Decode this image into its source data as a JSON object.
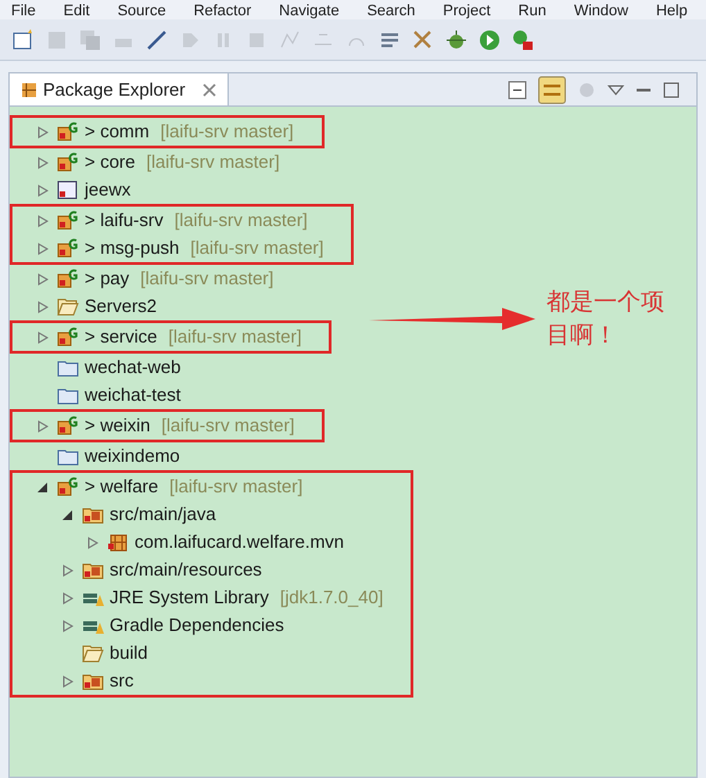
{
  "menu": [
    "File",
    "Edit",
    "Source",
    "Refactor",
    "Navigate",
    "Search",
    "Project",
    "Run",
    "Window",
    "Help"
  ],
  "view": {
    "title": "Package Explorer"
  },
  "tree": [
    {
      "label": "> comm",
      "branch": "[laifu-srv master]",
      "kind": "git-project",
      "expanded": false,
      "boxed": true
    },
    {
      "label": "> core",
      "branch": "[laifu-srv master]",
      "kind": "git-project",
      "expanded": false,
      "boxed": false
    },
    {
      "label": "jeewx",
      "kind": "web-project",
      "expanded": false,
      "boxed": false
    },
    {
      "label": "> laifu-srv",
      "branch": "[laifu-srv master]",
      "kind": "git-project",
      "expanded": false,
      "boxed": true
    },
    {
      "label": "> msg-push",
      "branch": "[laifu-srv master]",
      "kind": "git-project",
      "expanded": false,
      "boxed": true
    },
    {
      "label": "> pay",
      "branch": "[laifu-srv master]",
      "kind": "git-project",
      "expanded": false,
      "boxed": false
    },
    {
      "label": "Servers2",
      "kind": "folder-open",
      "expanded": false,
      "boxed": false
    },
    {
      "label": "> service",
      "branch": "[laifu-srv master]",
      "kind": "git-project",
      "expanded": false,
      "boxed": true
    },
    {
      "label": "wechat-web",
      "kind": "folder",
      "boxed": false
    },
    {
      "label": "weichat-test",
      "kind": "folder",
      "boxed": false
    },
    {
      "label": "> weixin",
      "branch": "[laifu-srv master]",
      "kind": "git-project",
      "expanded": false,
      "boxed": true
    },
    {
      "label": "weixindemo",
      "kind": "folder",
      "boxed": false
    },
    {
      "label": "> welfare",
      "branch": "[laifu-srv master]",
      "kind": "git-project",
      "expanded": true,
      "boxed": true,
      "children": [
        {
          "label": "src/main/java",
          "kind": "source-folder",
          "expanded": true,
          "children": [
            {
              "label": "com.laifucard.welfare.mvn",
              "kind": "package",
              "expanded": false
            }
          ]
        },
        {
          "label": "src/main/resources",
          "kind": "source-folder",
          "expanded": false
        },
        {
          "label": "JRE System Library",
          "branch": "[jdk1.7.0_40]",
          "kind": "library",
          "expanded": false
        },
        {
          "label": "Gradle Dependencies",
          "kind": "library",
          "expanded": false
        },
        {
          "label": "build",
          "kind": "folder-open"
        },
        {
          "label": "src",
          "kind": "source-folder",
          "expanded": false
        }
      ]
    }
  ],
  "annotation": {
    "note": "都是一个项目啊！"
  }
}
